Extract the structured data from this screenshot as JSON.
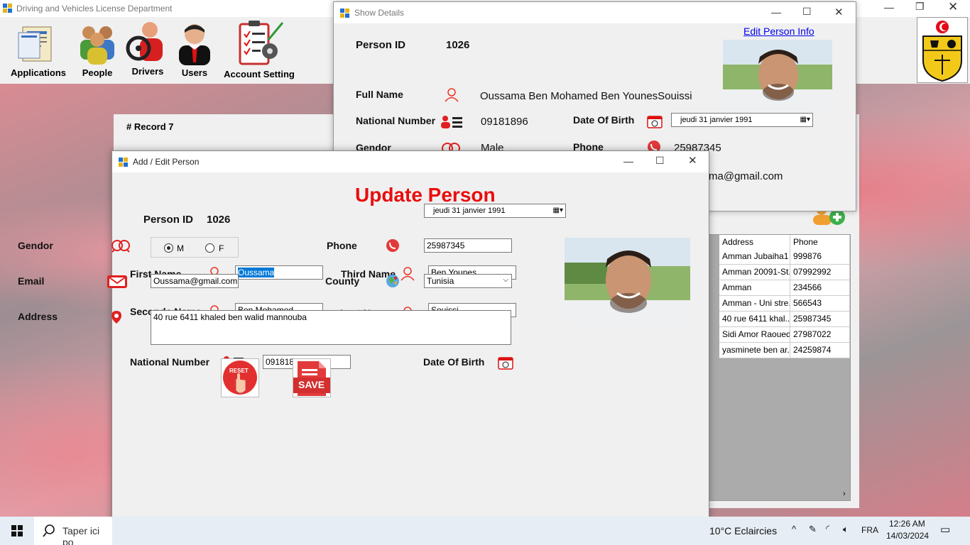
{
  "main": {
    "title": "Driving and Vehicles License Department",
    "toolbar": {
      "applications": "Applications",
      "people": "People",
      "drivers": "Drivers",
      "users": "Users",
      "account_setting": "Account Setting"
    },
    "record_count": "# Record 7"
  },
  "grid": {
    "headers": [
      "Address",
      "Phone"
    ],
    "rows": [
      [
        "Amman Jubaiha1",
        "999876"
      ],
      [
        "Amman 20091-St...",
        "07992992"
      ],
      [
        "Amman",
        "234566"
      ],
      [
        "Amman - Uni stre...",
        "566543"
      ],
      [
        "40 rue 6411 khal...",
        "25987345"
      ],
      [
        "Sidi Amor Raoued",
        "27987022"
      ],
      [
        "yasminete ben ar...",
        "24259874"
      ]
    ]
  },
  "details": {
    "title": "Show Details",
    "edit_link": "Edit Person Info",
    "person_id_label": "Person ID",
    "person_id": "1026",
    "full_name_label": "Full Name",
    "full_name": "Oussama Ben Mohamed Ben YounesSouissi",
    "national_number_label": "National Number",
    "national_number": "09181896",
    "dob_label": "Date Of Birth",
    "dob": "jeudi    31   janvier    1991",
    "gendor_label": "Gendor",
    "gendor": "Male",
    "phone_label": "Phone",
    "phone": "25987345",
    "email_partial": "ma@gmail.com"
  },
  "edit": {
    "title": "Add / Edit Person",
    "heading": "Update Person",
    "person_id_label": "Person ID",
    "person_id": "1026",
    "first_name_label": "First Name",
    "first_name": "Oussama",
    "third_name_label": "Third Name",
    "third_name": "Ben Younes",
    "second_name_label": "Seconde Name",
    "second_name": "Ben Mohamed",
    "last_name_label": "Last Name",
    "last_name": "Souissi",
    "national_number_label": "National Number",
    "national_number": "09181896",
    "dob_label": "Date Of Birth",
    "dob": "jeudi    31   janvier    1991",
    "gendor_label": "Gendor",
    "gender_m": "M",
    "gender_f": "F",
    "gender_selected": "M",
    "phone_label": "Phone",
    "phone": "25987345",
    "email_label": "Email",
    "email": "Oussama@gmail.com",
    "county_label": "County",
    "county": "Tunisia",
    "address_label": "Address",
    "address": "40 rue 6411 khaled ben walid mannouba",
    "reset_label": "RESET",
    "save_label": "SAVE"
  },
  "taskbar": {
    "search_placeholder": "Taper ici po",
    "weather": "10°C  Eclaircies",
    "language": "FRA",
    "time": "12:26 AM",
    "date": "14/03/2024"
  },
  "colors": {
    "accent_red": "#e3141b",
    "heading_red": "#ea0d0d",
    "link_blue": "#0000ee"
  }
}
